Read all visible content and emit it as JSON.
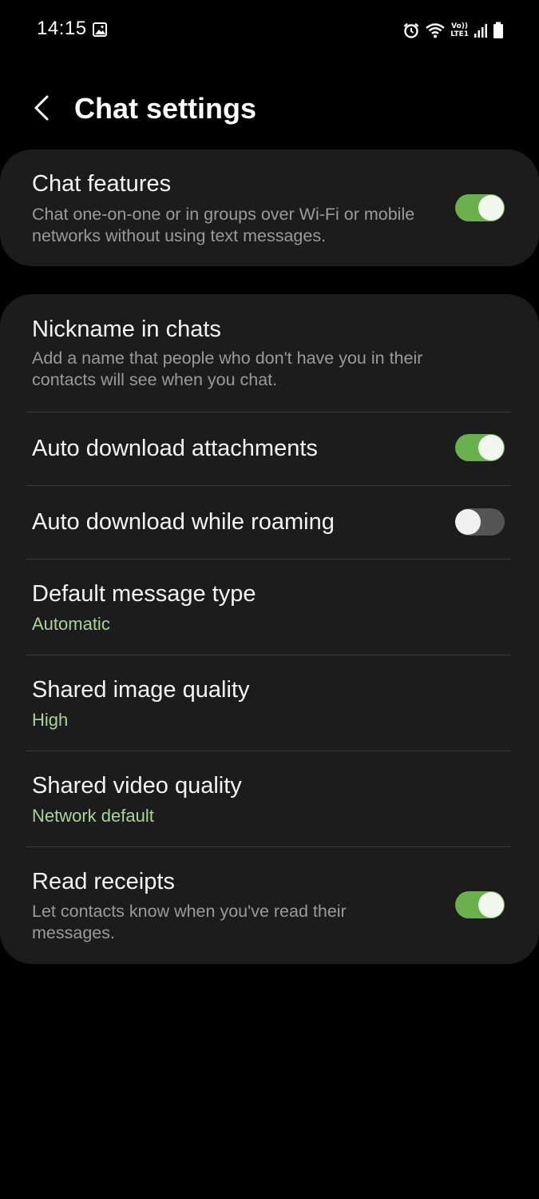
{
  "status_bar": {
    "time": "14:15",
    "volte_top": "Vo))",
    "volte_bottom": "LTE1"
  },
  "header": {
    "title": "Chat settings",
    "back_icon": "chevron-left-icon"
  },
  "colors": {
    "accent_green": "#6ab04c",
    "value_green": "#a9d49a",
    "card_bg": "#1c1c1c",
    "background": "#000000"
  },
  "sections": [
    {
      "items": [
        {
          "title": "Chat features",
          "description": "Chat one-on-one or in groups over Wi-Fi or mobile networks without using text messages.",
          "toggle": true
        }
      ]
    },
    {
      "items": [
        {
          "title": "Nickname in chats",
          "description": "Add a name that people who don't have you in their contacts will see when you chat."
        },
        {
          "title": "Auto download attachments",
          "toggle": true
        },
        {
          "title": "Auto download while roaming",
          "toggle": false
        },
        {
          "title": "Default message type",
          "value": "Automatic"
        },
        {
          "title": "Shared image quality",
          "value": "High"
        },
        {
          "title": "Shared video quality",
          "value": "Network default"
        },
        {
          "title": "Read receipts",
          "description": "Let contacts know when you've read their messages.",
          "toggle": true
        }
      ]
    }
  ]
}
